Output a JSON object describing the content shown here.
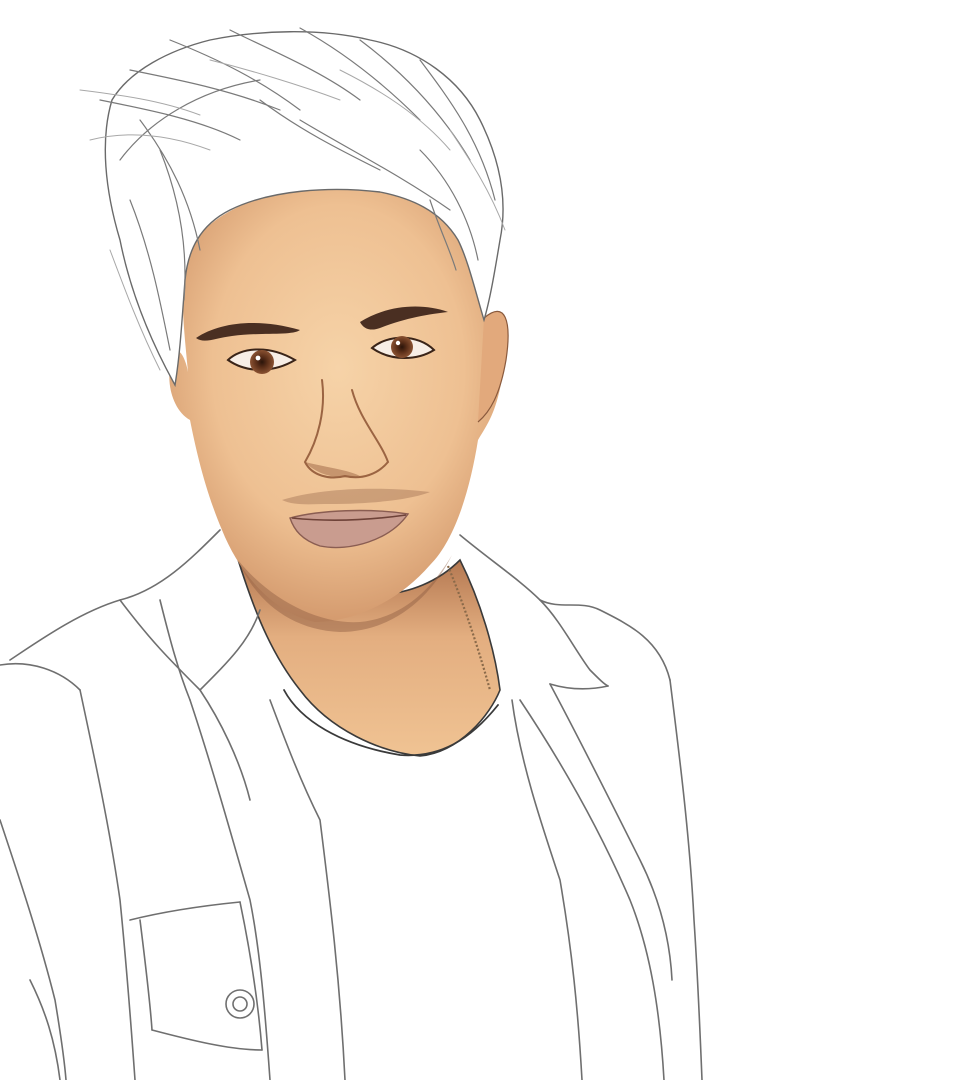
{
  "image": {
    "subject": "",
    "palette": {
      "background": "#ffffff",
      "skin": "#f0c89a",
      "skin_shadow": "#c98a5a",
      "lips": "#c79a8f",
      "iris": "#6b3b22",
      "line": "#6f6f6f"
    }
  }
}
